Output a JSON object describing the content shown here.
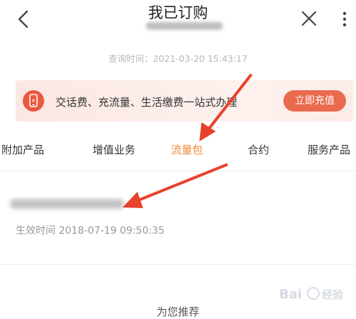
{
  "header": {
    "title": "我已订购",
    "query_time": "查询时间：2021-03-20 15:43:17"
  },
  "banner": {
    "icon": "phone-bill-icon",
    "text": "交话费、充流量、生活缴费一站式办理",
    "button_label": "立即充值"
  },
  "tabs": [
    {
      "label": "附加产品",
      "active": false
    },
    {
      "label": "增值业务",
      "active": false
    },
    {
      "label": "流量包",
      "active": true
    },
    {
      "label": "合约",
      "active": false
    },
    {
      "label": "服务产品",
      "active": false
    }
  ],
  "content": {
    "effective_time": "生效时间 2018-07-19 09:50:35"
  },
  "recommend": {
    "title": "为您推荐"
  },
  "watermark": {
    "text": "Bai经验"
  },
  "colors": {
    "accent": "#ef8a3a",
    "banner_button": "#ea6a4d",
    "arrow": "#e8412c"
  }
}
